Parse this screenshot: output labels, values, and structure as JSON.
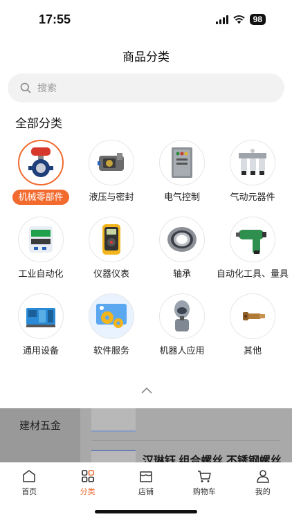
{
  "status_bar": {
    "time": "17:55",
    "battery": "98",
    "icons": [
      "signal-icon",
      "wifi-icon",
      "battery-icon"
    ]
  },
  "header": {
    "title": "商品分类"
  },
  "search": {
    "placeholder": "搜索",
    "value": ""
  },
  "section_title": "全部分类",
  "categories": [
    {
      "label": "机械零部件",
      "icon": "valve-icon",
      "active": true
    },
    {
      "label": "液压与密封",
      "icon": "hydraulic-pump-icon",
      "active": false
    },
    {
      "label": "电气控制",
      "icon": "control-cabinet-icon",
      "active": false
    },
    {
      "label": "气动元器件",
      "icon": "air-filter-icon",
      "active": false
    },
    {
      "label": "工业自动化",
      "icon": "pressure-display-icon",
      "active": false
    },
    {
      "label": "仪器仪表",
      "icon": "multimeter-icon",
      "active": false
    },
    {
      "label": "轴承",
      "icon": "bearing-icon",
      "active": false
    },
    {
      "label": "自动化工具、量具",
      "icon": "impact-wrench-icon",
      "active": false
    },
    {
      "label": "通用设备",
      "icon": "generator-icon",
      "active": false
    },
    {
      "label": "软件服务",
      "icon": "gears-icon",
      "active": false
    },
    {
      "label": "机器人应用",
      "icon": "robot-icon",
      "active": false
    },
    {
      "label": "其他",
      "icon": "fitting-icon",
      "active": false
    }
  ],
  "background": {
    "side_item": "建材五金",
    "product_title": "汉琳钰 组合螺丝 不锈钢螺丝"
  },
  "tab_bar": {
    "tabs": [
      {
        "label": "首页",
        "icon": "home-icon",
        "active": false
      },
      {
        "label": "分类",
        "icon": "category-grid-icon",
        "active": true
      },
      {
        "label": "店铺",
        "icon": "store-icon",
        "active": false
      },
      {
        "label": "购物车",
        "icon": "cart-icon",
        "active": false
      },
      {
        "label": "我的",
        "icon": "user-icon",
        "active": false
      }
    ]
  },
  "colors": {
    "accent": "#f26a2e",
    "search_bg": "#f2f2f2",
    "overlay": "#a9a9a9"
  }
}
